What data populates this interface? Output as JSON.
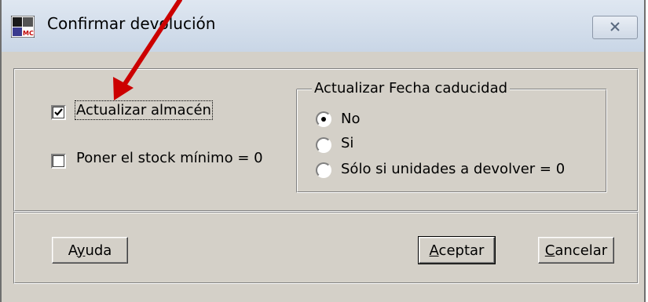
{
  "window": {
    "title": "Confirmar devolución",
    "app_icon": "mcp-app-icon",
    "close_icon": "close-icon"
  },
  "options": {
    "update_stock": {
      "label": "Actualizar almacén",
      "checked": true
    },
    "min_stock_zero": {
      "label": "Poner el stock mínimo = 0",
      "checked": false
    }
  },
  "expiry_group": {
    "title": "Actualizar Fecha caducidad",
    "selected": "No",
    "options": [
      {
        "label": "No",
        "selected": true
      },
      {
        "label": "Si",
        "selected": false
      },
      {
        "label": "Sólo si unidades a devolver = 0",
        "selected": false
      }
    ]
  },
  "buttons": {
    "help": {
      "label": "Ayuda",
      "mnemonic": "y"
    },
    "accept": {
      "label": "Aceptar",
      "mnemonic": "A"
    },
    "cancel": {
      "label": "Cancelar",
      "mnemonic": "C"
    }
  },
  "annotation": {
    "color": "#cc0000",
    "icon": "red-arrow"
  }
}
